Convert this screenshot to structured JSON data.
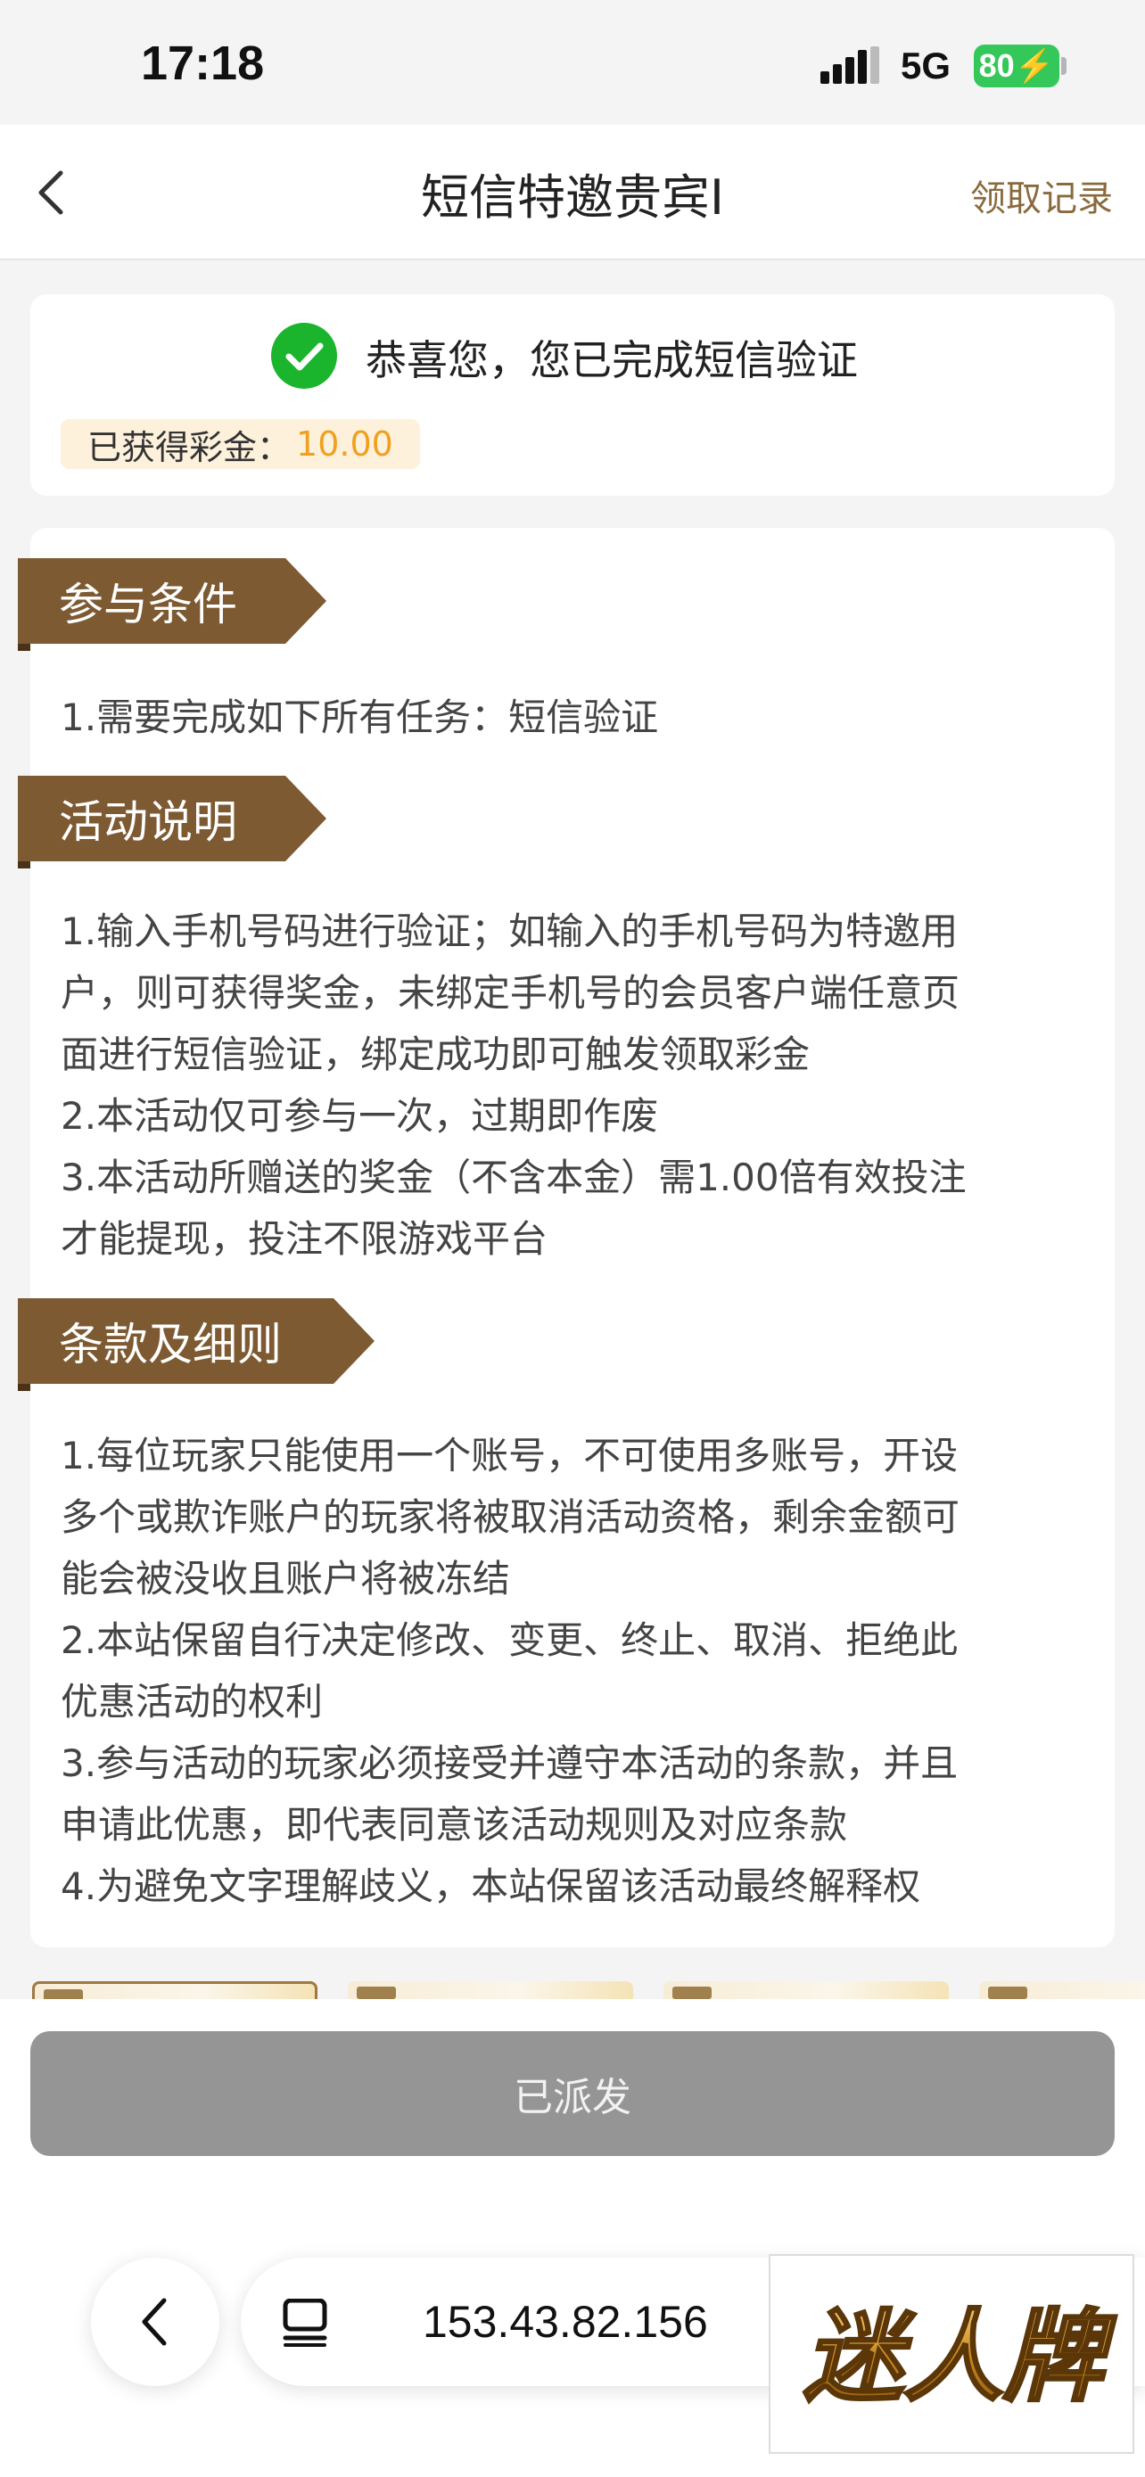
{
  "status_bar": {
    "time": "17:18",
    "network": "5G",
    "battery": "80"
  },
  "nav": {
    "title": "短信特邀贵宾I",
    "record_link": "领取记录"
  },
  "success": {
    "message": "恭喜您，您已完成短信验证",
    "bonus_label": "已获得彩金：",
    "bonus_value": "10.00"
  },
  "sections": [
    {
      "title": "参与条件",
      "lines": [
        "1.需要完成如下所有任务：短信验证"
      ]
    },
    {
      "title": "活动说明",
      "lines": [
        "1.输入手机号码进行验证；如输入的手机号码为特邀用",
        "户，则可获得奖金，未绑定手机号的会员客户端任意页",
        "面进行短信验证，绑定成功即可触发领取彩金",
        "2.本活动仅可参与一次，过期即作废",
        "3.本活动所赠送的奖金（不含本金）需1.00倍有效投注",
        "才能提现，投注不限游戏平台"
      ]
    },
    {
      "title": "条款及细则",
      "lines": [
        "1.每位玩家只能使用一个账号，不可使用多账号，开设",
        "多个或欺诈账户的玩家将被取消活动资格，剩余金额可",
        "能会被没收且账户将被冻结",
        "2.本站保留自行决定修改、变更、终止、取消、拒绝此",
        "优惠活动的权利",
        "3.参与活动的玩家必须接受并遵守本活动的条款，并且",
        "申请此优惠，即代表同意该活动规则及对应条款",
        "4.为避免文字理解歧义，本站保留该活动最终解释权"
      ]
    }
  ],
  "action_button": "已派发",
  "browser": {
    "url": "153.43.82.156"
  },
  "watermark_text": "迷人牌",
  "colors": {
    "accent_brown": "#7d5a32",
    "record_link": "#8a6a3c",
    "bonus_value": "#f0a020",
    "success_green": "#1ab52c",
    "button_gray": "#959595"
  }
}
